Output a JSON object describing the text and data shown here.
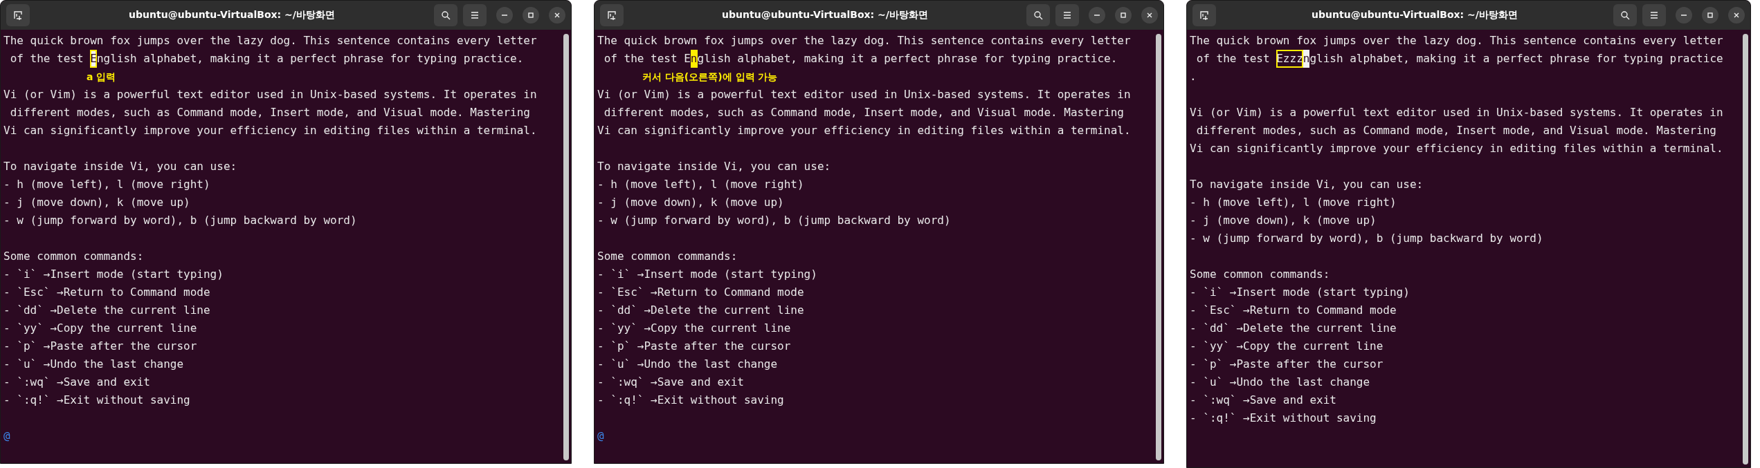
{
  "windows": [
    {
      "title": "ubuntu@ubuntu-VirtualBox: ~/바탕화면",
      "lines": [
        {
          "kind": "text",
          "text": "The quick brown fox jumps over the lazy dog. This sentence contains every letter"
        },
        {
          "kind": "segments",
          "segments": [
            {
              "kind": "plain",
              "text": " of the test "
            },
            {
              "kind": "boxed_cursor",
              "text": "E"
            },
            {
              "kind": "plain",
              "text": "nglish alphabet, making it a perfect phrase for typing practice."
            }
          ]
        },
        {
          "kind": "note",
          "text": "a 입력"
        },
        {
          "kind": "text",
          "text": "Vi (or Vim) is a powerful text editor used in Unix-based systems. It operates in"
        },
        {
          "kind": "text",
          "text": " different modes, such as Command mode, Insert mode, and Visual mode. Mastering"
        },
        {
          "kind": "text",
          "text": "Vi can significantly improve your efficiency in editing files within a terminal."
        },
        {
          "kind": "blank"
        },
        {
          "kind": "text",
          "text": "To navigate inside Vi, you can use:"
        },
        {
          "kind": "text",
          "text": "- h (move left), l (move right)"
        },
        {
          "kind": "text",
          "text": "- j (move down), k (move up)"
        },
        {
          "kind": "text",
          "text": "- w (jump forward by word), b (jump backward by word)"
        },
        {
          "kind": "blank"
        },
        {
          "kind": "text",
          "text": "Some common commands:"
        },
        {
          "kind": "text",
          "text": "- `i` →Insert mode (start typing)"
        },
        {
          "kind": "text",
          "text": "- `Esc` →Return to Command mode"
        },
        {
          "kind": "text",
          "text": "- `dd` →Delete the current line"
        },
        {
          "kind": "text",
          "text": "- `yy` →Copy the current line"
        },
        {
          "kind": "text",
          "text": "- `p` →Paste after the cursor"
        },
        {
          "kind": "text",
          "text": "- `u` →Undo the last change"
        },
        {
          "kind": "text",
          "text": "- `:wq` →Save and exit"
        },
        {
          "kind": "text",
          "text": "- `:q!` →Exit without saving"
        },
        {
          "kind": "blank"
        },
        {
          "kind": "marker",
          "text": "@"
        }
      ]
    },
    {
      "title": "ubuntu@ubuntu-VirtualBox: ~/바탕화면",
      "lines": [
        {
          "kind": "text",
          "text": "The quick brown fox jumps over the lazy dog. This sentence contains every letter"
        },
        {
          "kind": "segments",
          "segments": [
            {
              "kind": "plain",
              "text": " of the test E"
            },
            {
              "kind": "filled_cursor",
              "text": "n"
            },
            {
              "kind": "plain",
              "text": "glish alphabet, making it a perfect phrase for typing practice."
            }
          ]
        },
        {
          "kind": "note",
          "text": "커서 다음(오른쪽)에 입력 가능"
        },
        {
          "kind": "text",
          "text": "Vi (or Vim) is a powerful text editor used in Unix-based systems. It operates in"
        },
        {
          "kind": "text",
          "text": " different modes, such as Command mode, Insert mode, and Visual mode. Mastering"
        },
        {
          "kind": "text",
          "text": "Vi can significantly improve your efficiency in editing files within a terminal."
        },
        {
          "kind": "blank"
        },
        {
          "kind": "text",
          "text": "To navigate inside Vi, you can use:"
        },
        {
          "kind": "text",
          "text": "- h (move left), l (move right)"
        },
        {
          "kind": "text",
          "text": "- j (move down), k (move up)"
        },
        {
          "kind": "text",
          "text": "- w (jump forward by word), b (jump backward by word)"
        },
        {
          "kind": "blank"
        },
        {
          "kind": "text",
          "text": "Some common commands:"
        },
        {
          "kind": "text",
          "text": "- `i` →Insert mode (start typing)"
        },
        {
          "kind": "text",
          "text": "- `Esc` →Return to Command mode"
        },
        {
          "kind": "text",
          "text": "- `dd` →Delete the current line"
        },
        {
          "kind": "text",
          "text": "- `yy` →Copy the current line"
        },
        {
          "kind": "text",
          "text": "- `p` →Paste after the cursor"
        },
        {
          "kind": "text",
          "text": "- `u` →Undo the last change"
        },
        {
          "kind": "text",
          "text": "- `:wq` →Save and exit"
        },
        {
          "kind": "text",
          "text": "- `:q!` →Exit without saving"
        },
        {
          "kind": "blank"
        },
        {
          "kind": "marker",
          "text": "@"
        }
      ]
    },
    {
      "title": "ubuntu@ubuntu-VirtualBox: ~/바탕화면",
      "lines": [
        {
          "kind": "text",
          "text": "The quick brown fox jumps over the lazy dog. This sentence contains every letter"
        },
        {
          "kind": "segments",
          "segments": [
            {
              "kind": "plain",
              "text": " of the test "
            },
            {
              "kind": "boxed",
              "text": "Ezzz"
            },
            {
              "kind": "cursor",
              "text": "n"
            },
            {
              "kind": "plain",
              "text": "glish alphabet, making it a perfect phrase for typing practice"
            }
          ]
        },
        {
          "kind": "text",
          "text": "."
        },
        {
          "kind": "blank"
        },
        {
          "kind": "text",
          "text": "Vi (or Vim) is a powerful text editor used in Unix-based systems. It operates in"
        },
        {
          "kind": "text",
          "text": " different modes, such as Command mode, Insert mode, and Visual mode. Mastering"
        },
        {
          "kind": "text",
          "text": "Vi can significantly improve your efficiency in editing files within a terminal."
        },
        {
          "kind": "blank"
        },
        {
          "kind": "text",
          "text": "To navigate inside Vi, you can use:"
        },
        {
          "kind": "text",
          "text": "- h (move left), l (move right)"
        },
        {
          "kind": "text",
          "text": "- j (move down), k (move up)"
        },
        {
          "kind": "text",
          "text": "- w (jump forward by word), b (jump backward by word)"
        },
        {
          "kind": "blank"
        },
        {
          "kind": "text",
          "text": "Some common commands:"
        },
        {
          "kind": "text",
          "text": "- `i` →Insert mode (start typing)"
        },
        {
          "kind": "text",
          "text": "- `Esc` →Return to Command mode"
        },
        {
          "kind": "text",
          "text": "- `dd` →Delete the current line"
        },
        {
          "kind": "text",
          "text": "- `yy` →Copy the current line"
        },
        {
          "kind": "text",
          "text": "- `p` →Paste after the cursor"
        },
        {
          "kind": "text",
          "text": "- `u` →Undo the last change"
        },
        {
          "kind": "text",
          "text": "- `:wq` →Save and exit"
        },
        {
          "kind": "text",
          "text": "- `:q!` →Exit without saving"
        }
      ]
    }
  ]
}
